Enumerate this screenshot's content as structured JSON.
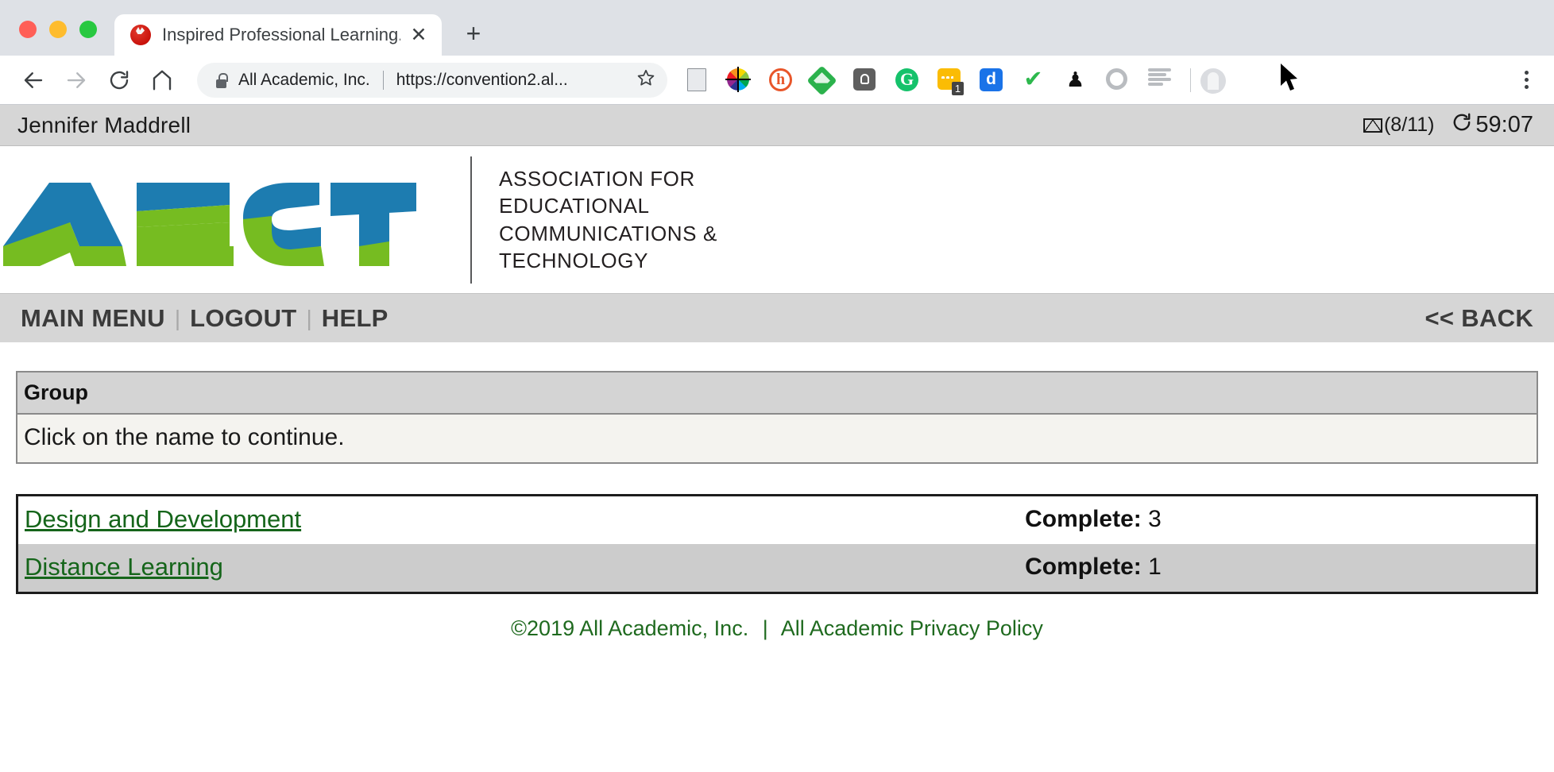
{
  "browser": {
    "tab": {
      "title": "Inspired Professional Learning.",
      "favicon": "tomato-timer-icon",
      "close_label": "✕"
    },
    "new_tab_label": "+",
    "nav": {
      "back": "back-arrow-icon",
      "forward": "forward-arrow-icon",
      "reload": "reload-icon",
      "home": "home-icon"
    },
    "omnibox": {
      "lock": "lock-icon",
      "origin": "All Academic, Inc.",
      "url": "https://convention2.al...",
      "bookmark": "star-icon"
    },
    "extensions": [
      {
        "name": "document-icon"
      },
      {
        "name": "color-wheel-icon"
      },
      {
        "name": "hypothesis-icon",
        "glyph": "h"
      },
      {
        "name": "feedly-icon"
      },
      {
        "name": "lightbulb-icon"
      },
      {
        "name": "grammarly-icon",
        "glyph": "G"
      },
      {
        "name": "sticky-notes-icon",
        "badge": "1"
      },
      {
        "name": "diigo-icon",
        "glyph": "d"
      },
      {
        "name": "green-check-icon",
        "glyph": "✔"
      },
      {
        "name": "ninja-icon",
        "glyph": "♟"
      },
      {
        "name": "gray-ring-icon"
      },
      {
        "name": "reader-lines-icon"
      }
    ],
    "profile_icon": "profile-avatar-icon",
    "menu_icon": "kebab-menu-icon"
  },
  "userbar": {
    "user_name": "Jennifer  Maddrell",
    "mail_icon": "envelope-icon",
    "mail_count": "(8/11)",
    "timer_icon": "session-refresh-icon",
    "timer_value": "59:07"
  },
  "branding": {
    "logo_alt": "AECT",
    "organization_lines": [
      "ASSOCIATION FOR",
      "EDUCATIONAL",
      "COMMUNICATIONS &",
      "TECHNOLOGY"
    ]
  },
  "navbar": {
    "items": [
      {
        "label": "MAIN MENU"
      },
      {
        "label": "LOGOUT"
      },
      {
        "label": "HELP"
      }
    ],
    "separator": "|",
    "back_label": "<< BACK"
  },
  "group_panel": {
    "header": "Group",
    "instruction": "Click on the name to continue."
  },
  "group_list": {
    "complete_label": "Complete:",
    "rows": [
      {
        "name": "Design and Development",
        "complete_count": "3"
      },
      {
        "name": "Distance Learning",
        "complete_count": "1"
      }
    ]
  },
  "footer": {
    "copyright": "©2019 All Academic, Inc.",
    "separator": "|",
    "privacy_link": "All Academic Privacy Policy"
  },
  "colors": {
    "logo_blue": "#1d7cb0",
    "logo_green": "#76bc21",
    "link_green": "#15651a",
    "footer_green": "#1f6a1f",
    "bar_gray": "#d6d6d6"
  }
}
